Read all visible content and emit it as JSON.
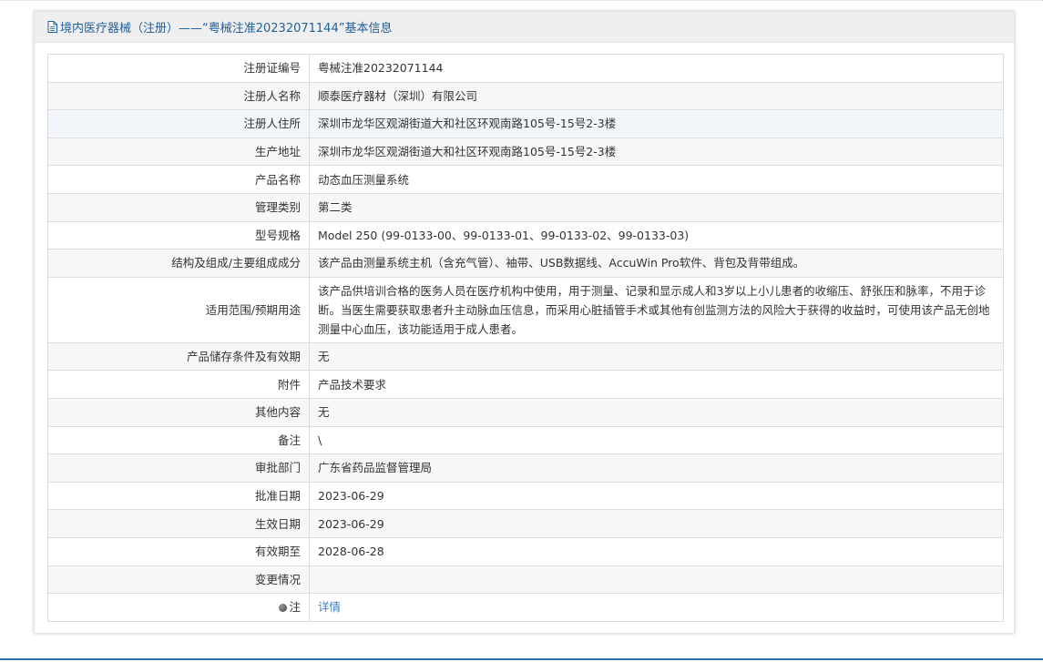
{
  "panel": {
    "title": "境内医疗器械（注册）——“粤械注准20232071144”基本信息",
    "title_icon": "document-icon"
  },
  "rows": [
    {
      "label": "注册证编号",
      "value": "粤械注准20232071144"
    },
    {
      "label": "注册人名称",
      "value": "顺泰医疗器材（深圳）有限公司"
    },
    {
      "label": "注册人住所",
      "value": "深圳市龙华区观湖街道大和社区环观南路105号-15号2-3楼"
    },
    {
      "label": "生产地址",
      "value": "深圳市龙华区观湖街道大和社区环观南路105号-15号2-3楼"
    },
    {
      "label": "产品名称",
      "value": "动态血压测量系统"
    },
    {
      "label": "管理类别",
      "value": "第二类"
    },
    {
      "label": "型号规格",
      "value": "Model 250 (99-0133-00、99-0133-01、99-0133-02、99-0133-03)"
    },
    {
      "label": "结构及组成/主要组成成分",
      "value": "该产品由测量系统主机（含充气管）、袖带、USB数据线、AccuWin Pro软件、背包及背带组成。"
    },
    {
      "label": "适用范围/预期用途",
      "value": "该产品供培训合格的医务人员在医疗机构中使用，用于测量、记录和显示成人和3岁以上小儿患者的收缩压、舒张压和脉率，不用于诊断。当医生需要获取患者升主动脉血压信息，而采用心脏插管手术或其他有创监测方法的风险大于获得的收益时，可使用该产品无创地测量中心血压，该功能适用于成人患者。"
    },
    {
      "label": "产品储存条件及有效期",
      "value": "无"
    },
    {
      "label": "附件",
      "value": "产品技术要求"
    },
    {
      "label": "其他内容",
      "value": "无"
    },
    {
      "label": "备注",
      "value": "\\"
    },
    {
      "label": "审批部门",
      "value": "广东省药品监督管理局"
    },
    {
      "label": "批准日期",
      "value": "2023-06-29"
    },
    {
      "label": "生效日期",
      "value": "2023-06-29"
    },
    {
      "label": "有效期至",
      "value": "2028-06-28"
    },
    {
      "label": "变更情况",
      "value": ""
    }
  ],
  "note_row": {
    "label": "注",
    "icon": "note-bullet-icon",
    "link": "详情"
  },
  "colors": {
    "title": "#1f5f9b",
    "link": "#3a7fc4",
    "border": "#dcdcdc",
    "header_bg": "#efefef",
    "bottom_bar": "#2e6da4"
  }
}
